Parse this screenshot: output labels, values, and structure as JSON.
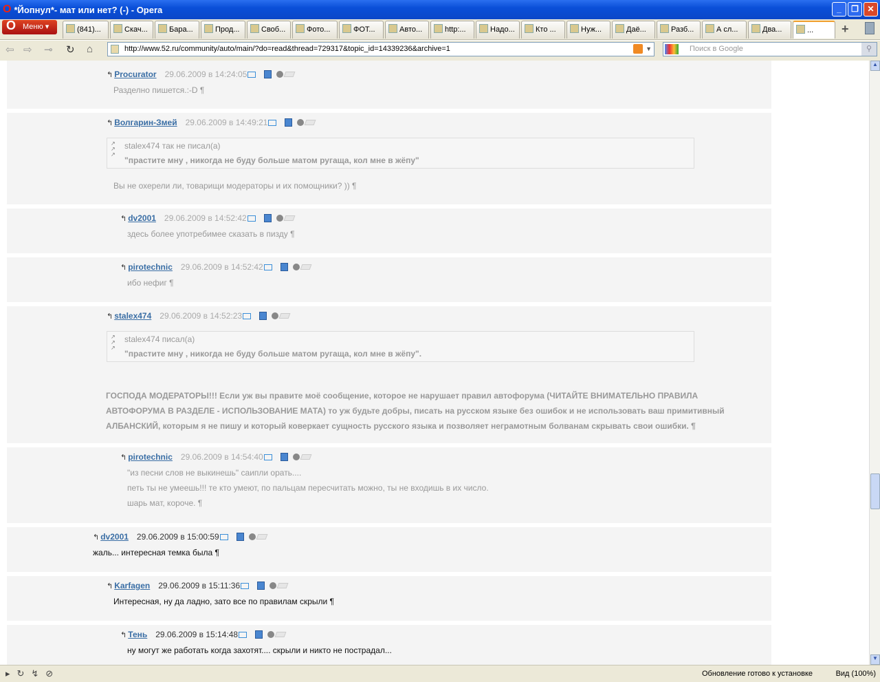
{
  "window": {
    "title": "*Йопнул*- мат или нет? (-) - Opera",
    "minimize": "_",
    "restore": "❐",
    "close": "✕"
  },
  "menu": {
    "label": "Меню"
  },
  "tabs": [
    "(841)...",
    "Скач...",
    "Бара...",
    "Прод...",
    "Своб...",
    "Фото...",
    "ФОТ...",
    "Авто...",
    "http:...",
    "Надо...",
    "Кто ...",
    "Нуж...",
    "Даё...",
    "Разб...",
    "А сл...",
    "Два...",
    "..."
  ],
  "address": {
    "url": "http://www.52.ru/community/auto/main/?do=read&thread=729317&topic_id=14339236&archive=1"
  },
  "search": {
    "placeholder": "Поиск в Google"
  },
  "posts": [
    {
      "author": "Procurator",
      "date": "29.06.2009 в 14:24:05",
      "style": "grey",
      "lines": [
        "Разделно пишется.:-D ¶"
      ]
    },
    {
      "author": "Волгарин-Змей",
      "date": "29.06.2009 в 14:49:21",
      "style": "grey",
      "quote": {
        "author": "stalex474 так не писал(а)",
        "text": "\"прастите мну , никогда не буду больше матом ругаща, кол мне в жёпу\""
      },
      "lines": [
        "Вы не охерели ли, товарищи модераторы и их помощники? )) ¶"
      ]
    },
    {
      "author": "dv2001",
      "date": "29.06.2009 в 14:52:42",
      "style": "grey",
      "lines": [
        "здесь более употребимее сказать в пизду ¶"
      ]
    },
    {
      "author": "pirotechnic",
      "date": "29.06.2009 в 14:52:42",
      "style": "grey",
      "lines": [
        "ибо нефиг ¶"
      ]
    },
    {
      "author": "stalex474",
      "date": "29.06.2009 в 14:52:23",
      "style": "grey",
      "quote": {
        "author": "stalex474 писал(а)",
        "text": "\"прастите мну , никогда не буду больше матом ругаща, кол мне в жёпу\"."
      },
      "lines": [
        "ГОСПОДА МОДЕРАТОРЫ!!! Если уж вы правите моё сообщение, которое не нарушает правил автофорума (ЧИТАЙТЕ ВНИМАТЕЛЬНО ПРАВИЛА АВТОФОРУМА В РАЗДЕЛЕ - ИСПОЛЬЗОВАНИЕ МАТА) то уж будьте добры, писать на русском языке без ошибок и не использовать ваш примитивный АЛБАНСКИЙ, которым я не пишу и который коверкает сущность русского языка и позволяет неграмотным болванам скрывать свои ошибки. ¶"
      ]
    },
    {
      "author": "pirotechnic",
      "date": "29.06.2009 в 14:54:40",
      "style": "grey",
      "lines": [
        "\"из песни слов не выкинешь\" саипли орать....",
        "петь ты не умеешь!!! те кто умеют, по пальцам пересчитать можно, ты не входишь в их число.",
        "шарь мат, короче. ¶"
      ]
    },
    {
      "author": "dv2001",
      "date": "29.06.2009 в 15:00:59",
      "style": "black",
      "lines": [
        "жаль... интересная темка была ¶"
      ]
    },
    {
      "author": "Karfagen",
      "date": "29.06.2009 в 15:11:36",
      "style": "black",
      "lines": [
        "Интересная, ну да ладно, зато все по правилам скрыли ¶"
      ]
    },
    {
      "author": "Тень",
      "date": "29.06.2009 в 15:14:48",
      "style": "black",
      "lines": [
        "ну могут же работать когда захотят.... скрыли и никто не пострадал..."
      ]
    }
  ],
  "status": {
    "text": "Обновление готово к установке",
    "zoom": "Вид (100%)"
  }
}
